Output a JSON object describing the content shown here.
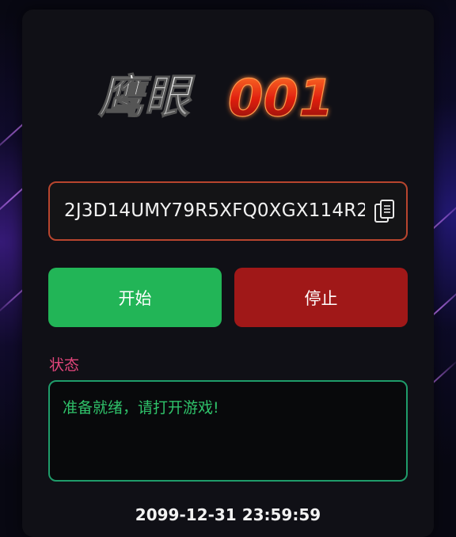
{
  "app": {
    "logo_text": "鹰眼001",
    "logo_part1": "鹰眼",
    "logo_part2": "001"
  },
  "key_field": {
    "value": "2J3D14UMY79R5XFQ0XGX114R2",
    "copy_icon": "copy-icon"
  },
  "buttons": {
    "start_label": "开始",
    "stop_label": "停止"
  },
  "status": {
    "label": "状态",
    "message": "准备就绪，请打开游戏!"
  },
  "footer": {
    "timestamp": "2099-12-31 23:59:59"
  },
  "colors": {
    "start_button": "#22b557",
    "stop_button": "#a01818",
    "status_label": "#e0457a",
    "status_text": "#2fc26a",
    "key_border": "#b8452e",
    "status_border": "#1f9c6a"
  }
}
